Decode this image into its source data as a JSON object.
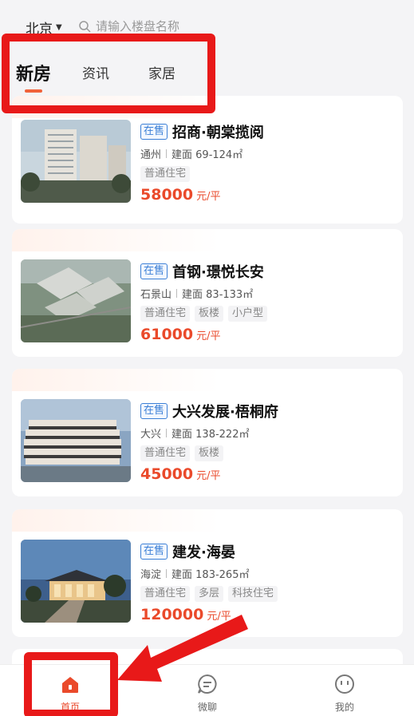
{
  "header": {
    "city": "北京",
    "search_placeholder": "请输入楼盘名称"
  },
  "tabs": [
    {
      "label": "新房",
      "active": true
    },
    {
      "label": "资讯",
      "active": false
    },
    {
      "label": "家居",
      "active": false
    }
  ],
  "listings": [
    {
      "status": "在售",
      "name": "招商·朝棠揽阅",
      "district": "通州",
      "area": "建面 69-124㎡",
      "tags": [
        "普通住宅"
      ],
      "price": "58000",
      "unit": "元/平"
    },
    {
      "status": "在售",
      "name": "首钢·璟悦长安",
      "district": "石景山",
      "area": "建面 83-133㎡",
      "tags": [
        "普通住宅",
        "板楼",
        "小户型"
      ],
      "price": "61000",
      "unit": "元/平"
    },
    {
      "status": "在售",
      "name": "大兴发展·梧桐府",
      "district": "大兴",
      "area": "建面 138-222㎡",
      "tags": [
        "普通住宅",
        "板楼"
      ],
      "price": "45000",
      "unit": "元/平"
    },
    {
      "status": "在售",
      "name": "建发·海晏",
      "district": "海淀",
      "area": "建面 183-265㎡",
      "tags": [
        "普通住宅",
        "多层",
        "科技住宅"
      ],
      "price": "120000",
      "unit": "元/平"
    }
  ],
  "bottom_nav": [
    {
      "label": "首页",
      "icon": "home-icon",
      "active": true
    },
    {
      "label": "微聊",
      "icon": "chat-icon",
      "active": false
    },
    {
      "label": "我的",
      "icon": "profile-icon",
      "active": false
    }
  ],
  "colors": {
    "accent": "#ea4a2b",
    "badge_blue": "#3b7fd6",
    "annotation_red": "#e81919"
  }
}
